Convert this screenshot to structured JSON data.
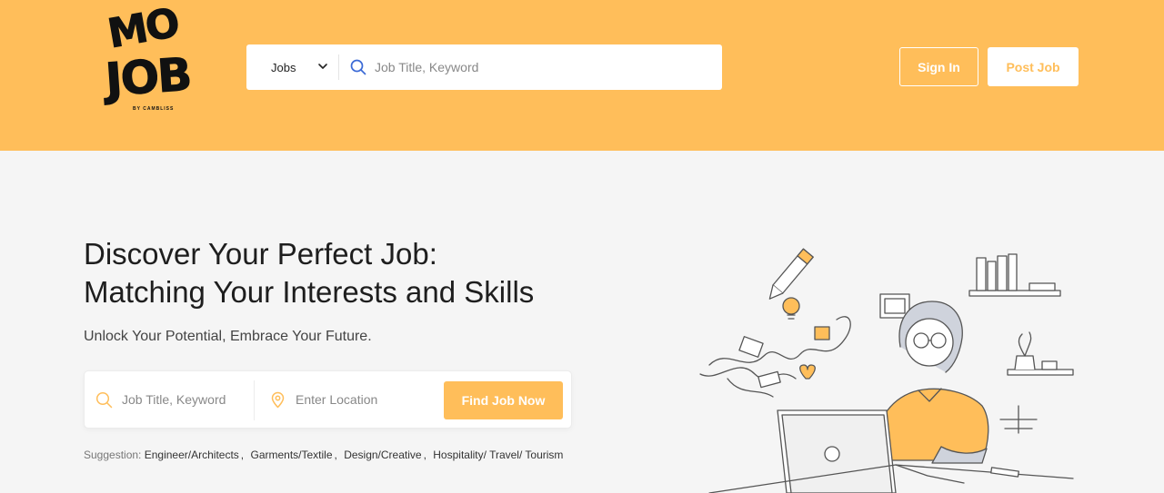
{
  "brand": {
    "logo_line1": "MO",
    "logo_line2": "JOB",
    "logo_tagline": "BY CAMBLISS"
  },
  "header": {
    "category_select": "Jobs",
    "search_placeholder": "Job Title, Keyword",
    "sign_in_label": "Sign In",
    "post_job_label": "Post Job"
  },
  "hero": {
    "title_line1": "Discover Your Perfect Job:",
    "title_line2": "Matching Your Interests and Skills",
    "subtitle": "Unlock Your Potential, Embrace Your Future."
  },
  "search": {
    "keyword_placeholder": "Job Title, Keyword",
    "location_placeholder": "Enter Location",
    "button_label": "Find Job Now"
  },
  "suggestions": {
    "label": "Suggestion:",
    "items": [
      "Engineer/Architects",
      "Garments/Textile",
      "Design/Creative",
      "Hospitality/ Travel/ Tourism"
    ],
    "separator": ","
  },
  "icons": {
    "header_search": "search-icon",
    "dropdown": "chevron-down-icon",
    "keyword": "search-icon",
    "location": "location-pin-icon"
  },
  "colors": {
    "accent": "#ffbe5a",
    "header_bg": "#ffbe5a",
    "page_bg": "#f5f5f5",
    "search_icon_blue": "#3b6ad6"
  }
}
